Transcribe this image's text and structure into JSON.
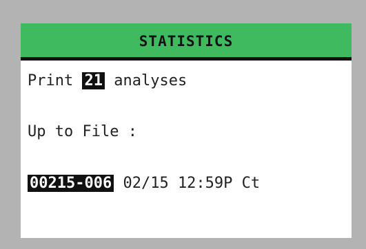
{
  "screen": {
    "title": "STATISTICS",
    "print_line": {
      "prefix": "Print",
      "count": "21",
      "suffix": "analyses"
    },
    "file_label": "Up to File :",
    "file_line": {
      "file_id": "00215-006",
      "details": "02/15 12:59P Ct"
    }
  },
  "colors": {
    "title_bar": "#3fba5e",
    "bezel": "#b3b3b3",
    "screen_bg": "#ffffff",
    "highlight_bg": "#111111"
  }
}
